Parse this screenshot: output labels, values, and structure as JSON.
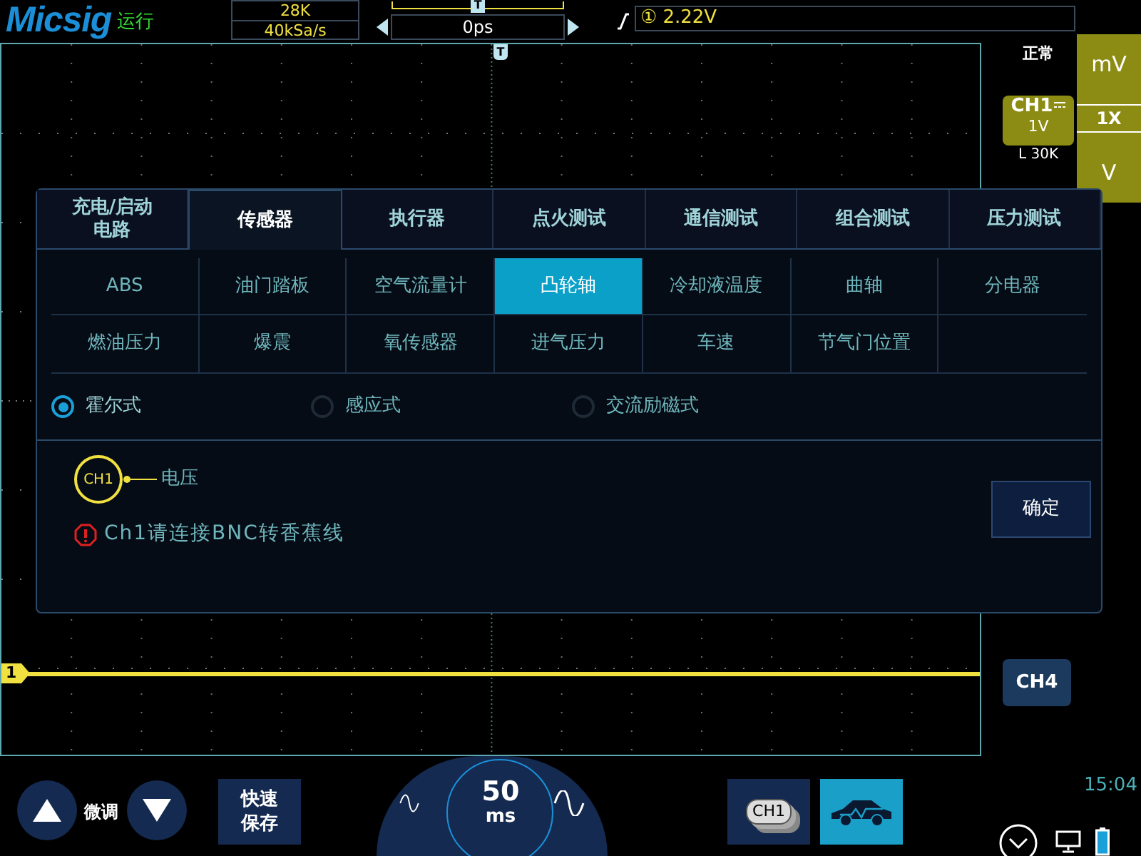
{
  "header": {
    "brand": "Micsig",
    "run_state": "运行",
    "memory_depth": "28K",
    "sample_rate": "40kSa/s",
    "trigger_position_marker": "T",
    "time_offset": "0ps",
    "trigger_source": "①",
    "trigger_level": "2.22V"
  },
  "screen": {
    "trigger_marker": "T",
    "trace_marker": "1",
    "ch4_button": "CH4"
  },
  "right_panel": {
    "acquisition_mode": "正常",
    "channel": {
      "label": "CH1",
      "scale": "1V",
      "impedance": "L 30K"
    },
    "units": [
      {
        "label": "mV",
        "selected": false
      },
      {
        "label": "1X",
        "selected": true
      },
      {
        "label": "V",
        "selected": false
      }
    ]
  },
  "dialog": {
    "tabs": [
      {
        "label": "充电/启动电路",
        "selected": false
      },
      {
        "label": "传感器",
        "selected": true
      },
      {
        "label": "执行器",
        "selected": false
      },
      {
        "label": "点火测试",
        "selected": false
      },
      {
        "label": "通信测试",
        "selected": false
      },
      {
        "label": "组合测试",
        "selected": false
      },
      {
        "label": "压力测试",
        "selected": false
      }
    ],
    "sensors": [
      {
        "label": "ABS",
        "selected": false
      },
      {
        "label": "油门踏板",
        "selected": false
      },
      {
        "label": "空气流量计",
        "selected": false
      },
      {
        "label": "凸轮轴",
        "selected": true
      },
      {
        "label": "冷却液温度",
        "selected": false
      },
      {
        "label": "曲轴",
        "selected": false
      },
      {
        "label": "分电器",
        "selected": false
      },
      {
        "label": "燃油压力",
        "selected": false
      },
      {
        "label": "爆震",
        "selected": false
      },
      {
        "label": "氧传感器",
        "selected": false
      },
      {
        "label": "进气压力",
        "selected": false
      },
      {
        "label": "车速",
        "selected": false
      },
      {
        "label": "节气门位置",
        "selected": false
      }
    ],
    "sensor_types": [
      {
        "label": "霍尔式",
        "selected": true
      },
      {
        "label": "感应式",
        "selected": false
      },
      {
        "label": "交流励磁式",
        "selected": false
      }
    ],
    "connection": {
      "probe": "CH1",
      "signal": "电压"
    },
    "warning": "Ch1请连接BNC转香蕉线",
    "confirm_button": "确定"
  },
  "bottom_bar": {
    "fine_adjust": "微调",
    "quick_save": "快速保存",
    "timebase_value": "50",
    "timebase_unit": "ms",
    "channel_button": "CH1",
    "time": "15:04"
  }
}
